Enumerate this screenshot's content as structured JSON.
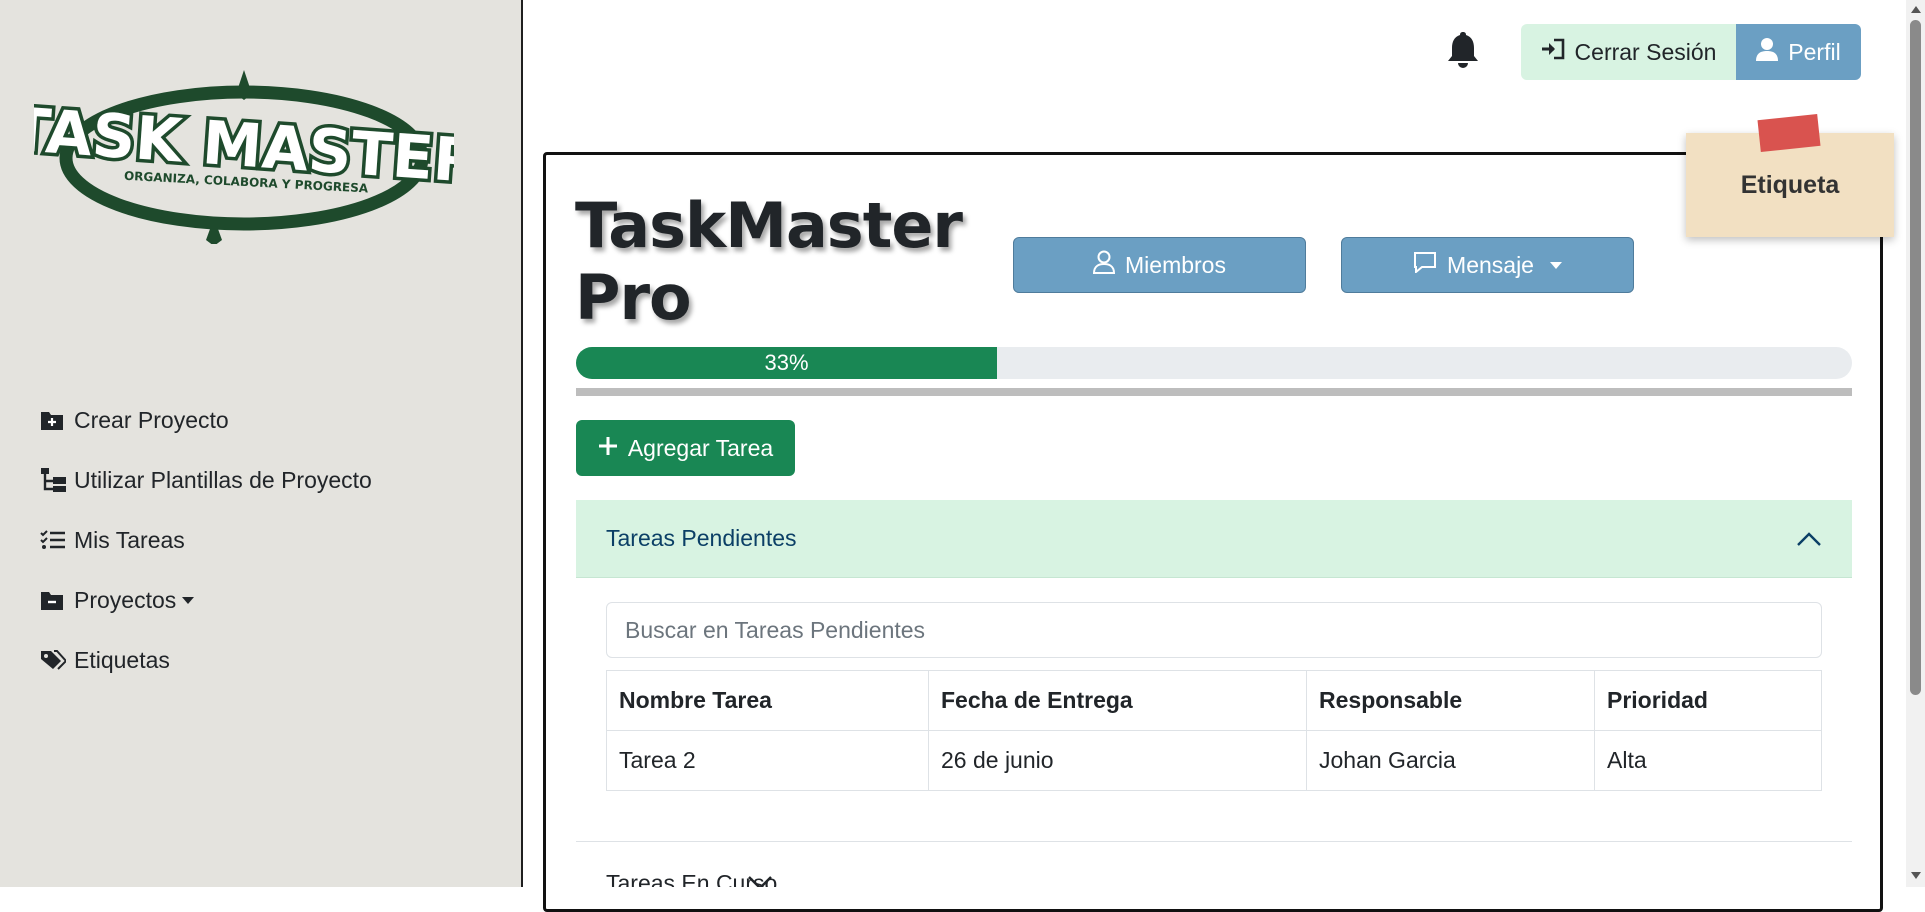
{
  "app": {
    "logo": {
      "title": "TASK MASTER",
      "tagline": "ORGANIZA, COLABORA Y PROGRESA"
    }
  },
  "sidebar": {
    "items": [
      {
        "label": "Crear Proyecto",
        "icon": "folder-plus-icon"
      },
      {
        "label": "Utilizar Plantillas de Proyecto",
        "icon": "diagram-icon"
      },
      {
        "label": "Mis Tareas",
        "icon": "checklist-icon"
      },
      {
        "label": "Proyectos",
        "icon": "folder-minus-icon",
        "dropdown": true
      },
      {
        "label": "Etiquetas",
        "icon": "tags-icon"
      }
    ]
  },
  "topbar": {
    "notifications_icon": "bell-icon",
    "logout_label": "Cerrar Sesión",
    "profile_label": "Perfil"
  },
  "project": {
    "title_line1": "TaskMaster",
    "title_line2": "Pro",
    "members_label": "Miembros",
    "message_label": "Mensaje",
    "progress": {
      "percent": 33,
      "label": "33%"
    },
    "add_task_label": "Agregar Tarea"
  },
  "note": {
    "label": "Etiqueta"
  },
  "pending": {
    "header": "Tareas Pendientes",
    "search_placeholder": "Buscar en Tareas Pendientes",
    "columns": [
      "Nombre Tarea",
      "Fecha de Entrega",
      "Responsable",
      "Prioridad"
    ],
    "rows": [
      [
        "Tarea 2",
        "26 de junio",
        "Johan Garcia",
        "Alta"
      ]
    ]
  },
  "in_progress": {
    "header": "Tareas En Curso"
  },
  "colors": {
    "sidebar_bg": "#e4e3de",
    "accent_green": "#198754",
    "accent_blue": "#6b9fc3",
    "light_green": "#d8f3e2",
    "logo_green": "#1e4a2c",
    "note_bg": "#f2e0c2",
    "tape_red": "#d9534f"
  }
}
